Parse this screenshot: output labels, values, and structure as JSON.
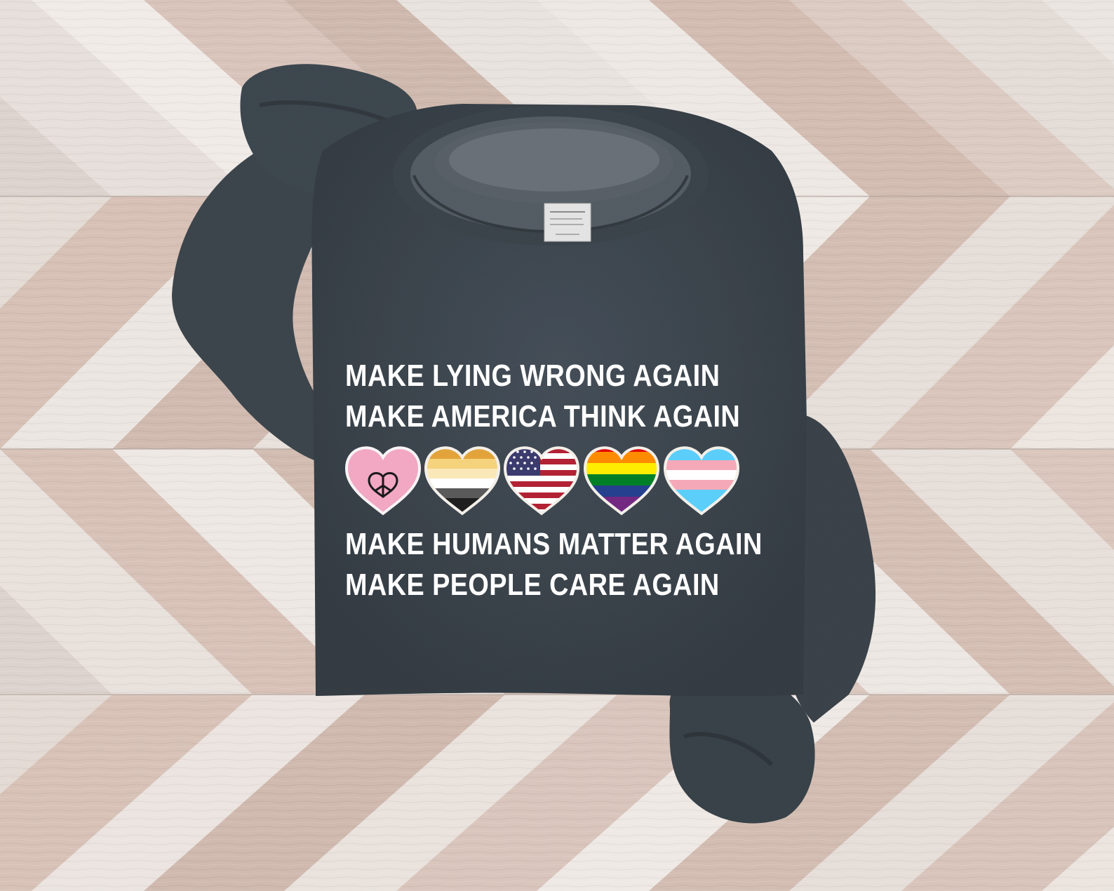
{
  "print": {
    "lines": [
      "MAKE LYING WRONG AGAIN",
      "MAKE AMERICA THINK AGAIN",
      "MAKE HUMANS MATTER AGAIN",
      "MAKE PEOPLE CARE AGAIN"
    ]
  },
  "hearts": [
    {
      "name": "peace-heart",
      "colors": [
        "#f2a7c3",
        "#1a1a1a"
      ]
    },
    {
      "name": "bear-pride-heart",
      "colors": [
        "#d86a12",
        "#e2a43a",
        "#f5d27c",
        "#fbe8b8",
        "#ffffff",
        "#5a5a5a",
        "#1f1f1f"
      ]
    },
    {
      "name": "american-flag-heart",
      "colors": [
        "#b22234",
        "#ffffff",
        "#3c3b6e"
      ]
    },
    {
      "name": "rainbow-pride-heart",
      "colors": [
        "#e40303",
        "#ff8c00",
        "#ffed00",
        "#008026",
        "#24408e",
        "#732982"
      ]
    },
    {
      "name": "transgender-heart",
      "colors": [
        "#5bcefa",
        "#f5a9b8",
        "#ffffff"
      ]
    }
  ],
  "colors": {
    "sweatshirt": "#3d464d",
    "wood_light": "#e8e1dc",
    "wood_pink": "#d7bfb5",
    "print_text": "#ffffff"
  }
}
